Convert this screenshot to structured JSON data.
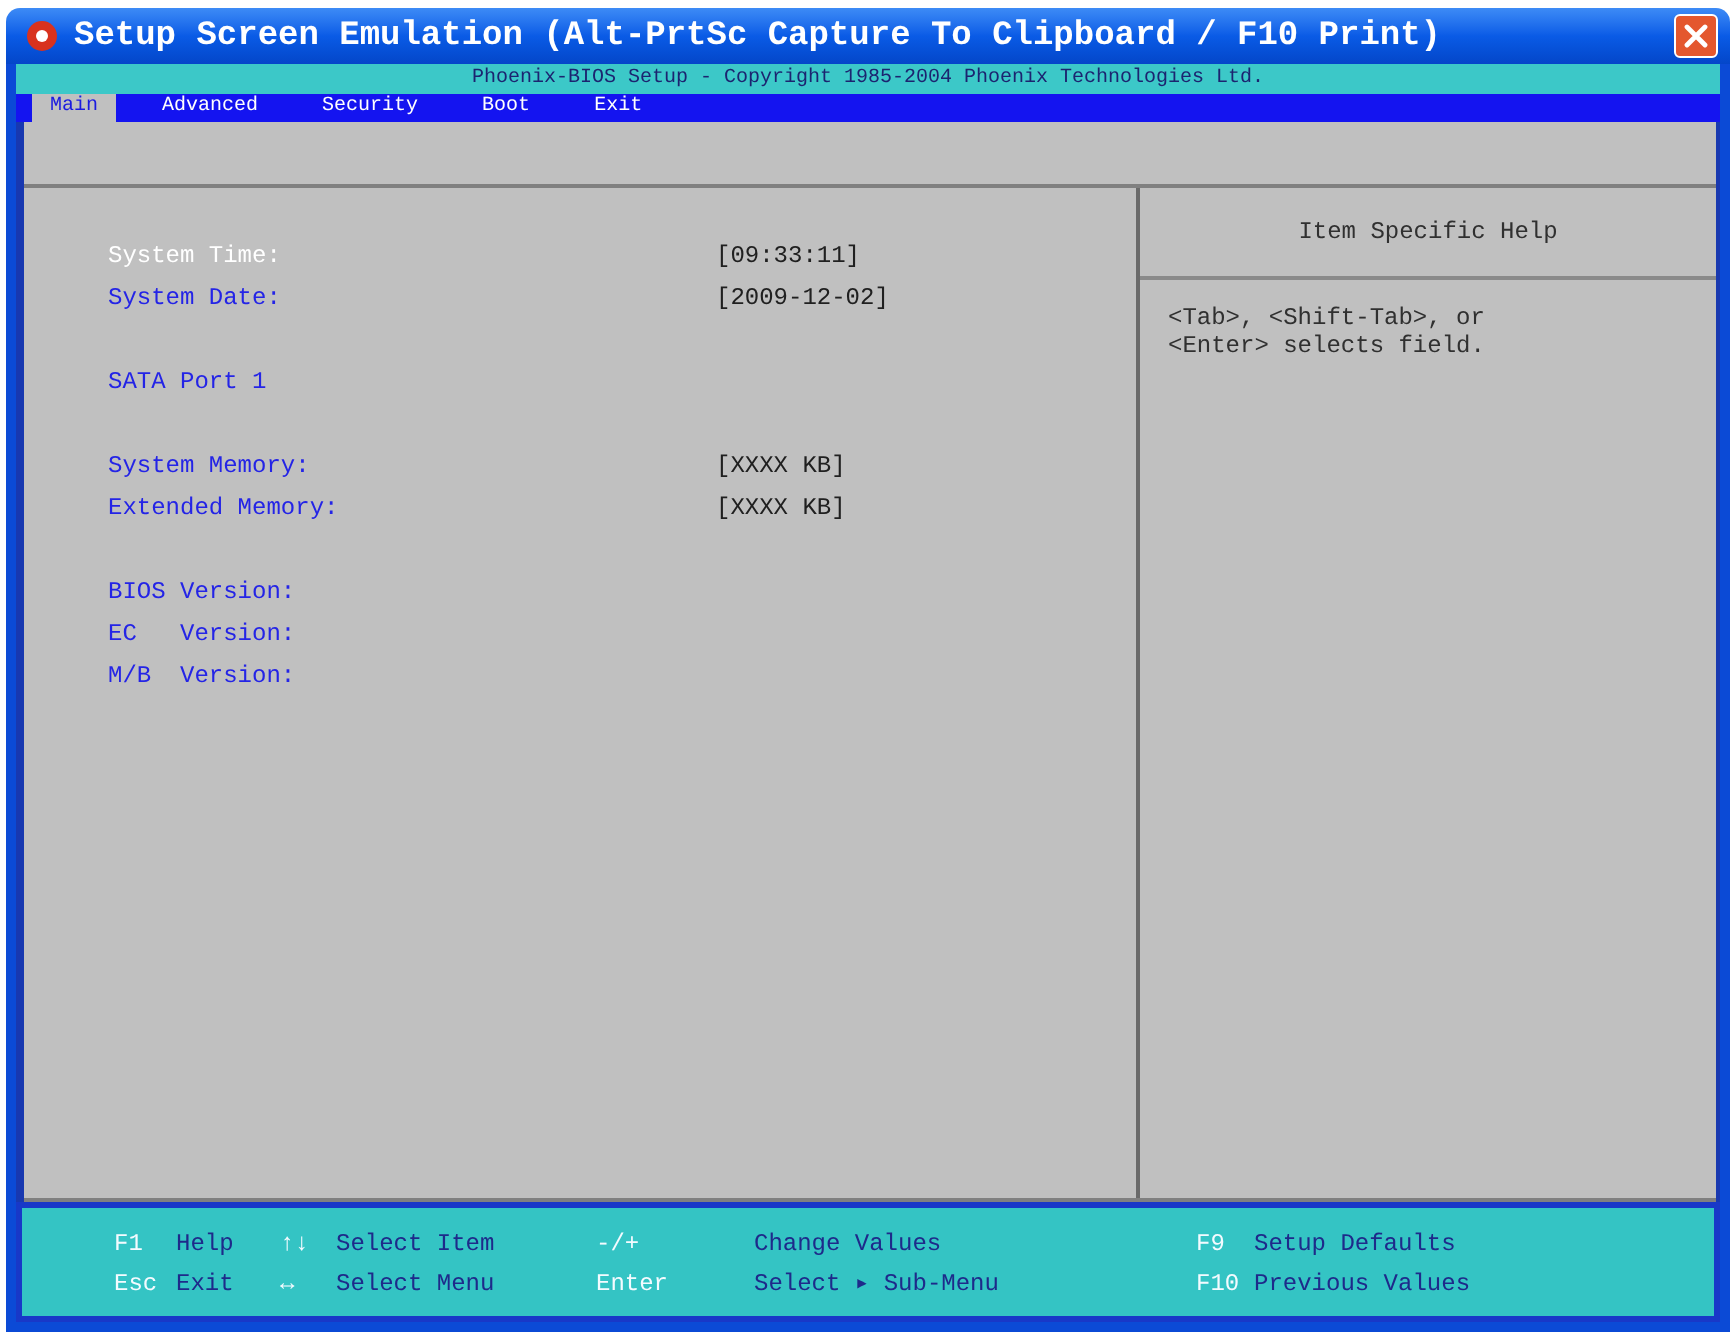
{
  "window": {
    "title": "Setup Screen Emulation (Alt-PrtSc Capture To Clipboard / F10 Print)"
  },
  "banner": {
    "text": "Phoenix-BIOS Setup - Copyright 1985-2004 Phoenix Technologies Ltd."
  },
  "tabs": [
    {
      "label": "Main",
      "selected": true
    },
    {
      "label": "Advanced",
      "selected": false
    },
    {
      "label": "Security",
      "selected": false
    },
    {
      "label": "Boot",
      "selected": false
    },
    {
      "label": "Exit",
      "selected": false
    }
  ],
  "item_groups": [
    [
      {
        "label": "System Time:",
        "value": "[09:33:11]",
        "selected": true
      },
      {
        "label": "System Date:",
        "value": "[2009-12-02]",
        "selected": false
      }
    ],
    [
      {
        "label": "SATA Port 1",
        "selected": false
      }
    ],
    [
      {
        "label": "System Memory:",
        "value": "[XXXX KB]",
        "selected": false
      },
      {
        "label": "Extended Memory:",
        "value": "[XXXX KB]",
        "selected": false
      }
    ],
    [
      {
        "label": "BIOS Version:",
        "selected": false
      },
      {
        "label": "EC   Version:",
        "selected": false
      },
      {
        "label": "M/B  Version:",
        "selected": false
      }
    ]
  ],
  "help_panel": {
    "title": "Item Specific Help",
    "text": "<Tab>, <Shift-Tab>, or <Enter> selects field."
  },
  "key_legend": [
    [
      {
        "key": "F1",
        "action": "Help"
      },
      {
        "key": "↑↓",
        "action": "Select Item"
      },
      {
        "key": "-/+",
        "action": "Change Values"
      },
      {
        "key": "F9",
        "action": "Setup Defaults"
      }
    ],
    [
      {
        "key": "Esc",
        "action": "Exit"
      },
      {
        "key": "↔",
        "action": "Select Menu"
      },
      {
        "key": "Enter",
        "action": "Select ▸ Sub-Menu"
      },
      {
        "key": "F10",
        "action": "Previous Values"
      }
    ]
  ]
}
